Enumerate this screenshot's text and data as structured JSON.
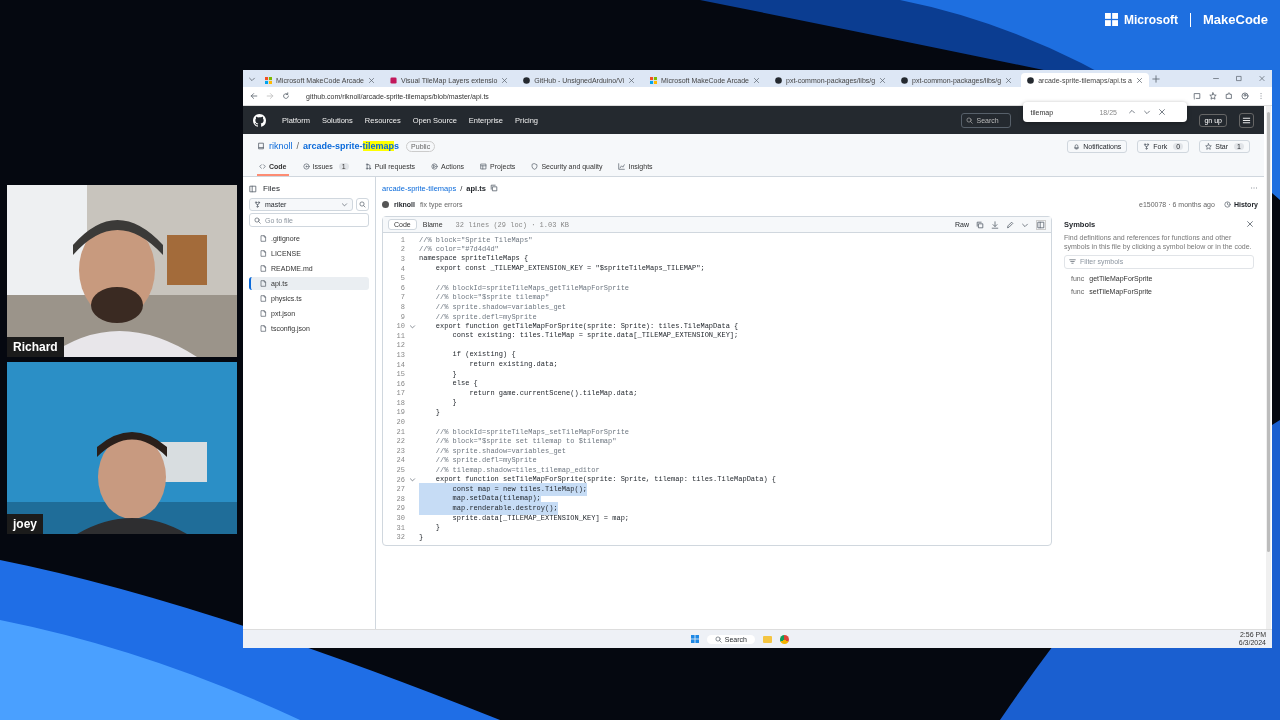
{
  "brand": {
    "company": "Microsoft",
    "name": "MakeCode"
  },
  "participants": [
    {
      "name": "Richard",
      "kind": "picture"
    },
    {
      "name": "joey",
      "kind": "picture"
    }
  ],
  "browser": {
    "tabs": [
      {
        "title": "Microsoft MakeCode Arcade",
        "kind": "makecode",
        "selected": false
      },
      {
        "title": "Visual TileMap Layers extensio",
        "kind": "extension",
        "selected": false
      },
      {
        "title": "GitHub - UnsignedArduino/Vi",
        "kind": "github",
        "selected": false
      },
      {
        "title": "Microsoft MakeCode Arcade",
        "kind": "makecode",
        "selected": false
      },
      {
        "title": "pxt-common-packages/libs/g",
        "kind": "github",
        "selected": false
      },
      {
        "title": "pxt-common-packages/libs/g",
        "kind": "github",
        "selected": false
      },
      {
        "title": "arcade-sprite-tilemaps/api.ts a",
        "kind": "github",
        "selected": true
      }
    ],
    "url": "github.com/riknoll/arcade-sprite-tilemaps/blob/master/api.ts",
    "find_bar": {
      "query": "tilemap",
      "count": "18/25"
    }
  },
  "github": {
    "nav": [
      "Platform",
      "Solutions",
      "Resources",
      "Open Source",
      "Enterprise",
      "Pricing"
    ],
    "search": {
      "placeholder": "Search"
    },
    "signup": "gn up",
    "repo": {
      "owner": "riknoll",
      "separator": "/",
      "name_before": "arcade-sprite-",
      "name_match": "tilemap",
      "name_after": "s",
      "visibility": "Public"
    },
    "actions": [
      {
        "label": "Notifications",
        "kind": "bell"
      },
      {
        "label": "Fork",
        "kind": "fork",
        "count": "0"
      },
      {
        "label": "Star",
        "kind": "star",
        "count": "1"
      }
    ],
    "repo_tabs": [
      {
        "label": "Code",
        "kind": "code",
        "selected": true
      },
      {
        "label": "Issues",
        "kind": "issue",
        "count": "1",
        "selected": false
      },
      {
        "label": "Pull requests",
        "kind": "pr",
        "selected": false
      },
      {
        "label": "Actions",
        "kind": "play",
        "selected": false
      },
      {
        "label": "Projects",
        "kind": "table",
        "selected": false
      },
      {
        "label": "Security and quality",
        "kind": "shield",
        "selected": false
      },
      {
        "label": "Insights",
        "kind": "graph",
        "selected": false
      }
    ]
  },
  "files": {
    "title": "Files",
    "branch": "master",
    "search": {
      "placeholder": "Go to file"
    },
    "items": [
      {
        "name": ".gitignore",
        "selected": false
      },
      {
        "name": "LICENSE",
        "selected": false
      },
      {
        "name": "README.md",
        "selected": false
      },
      {
        "name": "api.ts",
        "selected": true
      },
      {
        "name": "physics.ts",
        "selected": false
      },
      {
        "name": "pxt.json",
        "selected": false
      },
      {
        "name": "tsconfig.json",
        "selected": false
      }
    ]
  },
  "file": {
    "breadcrumb": [
      "arcade-sprite-tilemaps",
      "api.ts"
    ],
    "separator": "/",
    "author": "riknoll",
    "message": "fix type errors",
    "commit": "e150078 · 6 months ago",
    "history": "History",
    "views": [
      {
        "label": "Code",
        "selected": true
      },
      {
        "label": "Blame",
        "selected": false
      }
    ],
    "stats": "32 lines (29 loc) · 1.03 KB",
    "raw": "Raw",
    "lines": [
      {
        "n": "1",
        "text": "//% block=\"Sprite TileMaps\"",
        "kind": "comment",
        "fold": false,
        "selected": false
      },
      {
        "n": "2",
        "text": "//% color=\"#7d4d4d\"",
        "kind": "comment",
        "fold": false,
        "selected": false
      },
      {
        "n": "3",
        "text": "namespace spriteTileMaps {",
        "kind": "code",
        "fold": false,
        "selected": false
      },
      {
        "n": "4",
        "text": "    export const _TILEMAP_EXTENSION_KEY = \"$spriteTileMaps_TILEMAP\";",
        "kind": "code",
        "fold": false,
        "selected": false
      },
      {
        "n": "5",
        "fold": false,
        "selected": false
      },
      {
        "n": "6",
        "text": "    //% blockId=spriteTileMaps_getTileMapForSprite",
        "kind": "comment",
        "fold": false,
        "selected": false
      },
      {
        "n": "7",
        "text": "    //% block=\"$sprite tilemap\"",
        "kind": "comment",
        "fold": false,
        "selected": false
      },
      {
        "n": "8",
        "text": "    //% sprite.shadow=variables_get",
        "kind": "comment",
        "fold": false,
        "selected": false
      },
      {
        "n": "9",
        "text": "    //% sprite.defl=mySprite",
        "kind": "comment",
        "fold": false,
        "selected": false
      },
      {
        "n": "10",
        "text": "    export function getTileMapForSprite(sprite: Sprite): tiles.TileMapData {",
        "kind": "code",
        "fold": true,
        "selected": false
      },
      {
        "n": "11",
        "text": "        const existing: tiles.TileMap = sprite.data[_TILEMAP_EXTENSION_KEY];",
        "kind": "code",
        "fold": false,
        "selected": false
      },
      {
        "n": "12",
        "fold": false,
        "selected": false
      },
      {
        "n": "13",
        "text": "        if (existing) {",
        "kind": "code",
        "fold": false,
        "selected": false
      },
      {
        "n": "14",
        "text": "            return existing.data;",
        "kind": "code",
        "fold": false,
        "selected": false
      },
      {
        "n": "15",
        "text": "        }",
        "kind": "code",
        "fold": false,
        "selected": false
      },
      {
        "n": "16",
        "text": "        else {",
        "kind": "code",
        "fold": false,
        "selected": false
      },
      {
        "n": "17",
        "text": "            return game.currentScene().tileMap.data;",
        "kind": "code",
        "fold": false,
        "selected": false
      },
      {
        "n": "18",
        "text": "        }",
        "kind": "code",
        "fold": false,
        "selected": false
      },
      {
        "n": "19",
        "text": "    }",
        "kind": "code",
        "fold": false,
        "selected": false
      },
      {
        "n": "20",
        "fold": false,
        "selected": false
      },
      {
        "n": "21",
        "text": "    //% blockId=spriteTileMaps_setTileMapForSprite",
        "kind": "comment",
        "fold": false,
        "selected": false
      },
      {
        "n": "22",
        "text": "    //% block=\"$sprite set tilemap to $tilemap\"",
        "kind": "comment",
        "fold": false,
        "selected": false
      },
      {
        "n": "23",
        "text": "    //% sprite.shadow=variables_get",
        "kind": "comment",
        "fold": false,
        "selected": false
      },
      {
        "n": "24",
        "text": "    //% sprite.defl=mySprite",
        "kind": "comment",
        "fold": false,
        "selected": false
      },
      {
        "n": "25",
        "text": "    //% tilemap.shadow=tiles_tilemap_editor",
        "kind": "comment",
        "fold": false,
        "selected": false
      },
      {
        "n": "26",
        "text": "    export function setTileMapForSprite(sprite: Sprite, tilemap: tiles.TileMapData) {",
        "kind": "code",
        "fold": true,
        "selected": false
      },
      {
        "n": "27",
        "text": "        const map = new tiles.TileMap();",
        "kind": "code",
        "fold": false,
        "selected": true
      },
      {
        "n": "28",
        "text": "        map.setData(tilemap);",
        "kind": "code",
        "fold": false,
        "selected": true
      },
      {
        "n": "29",
        "text": "        map.renderable.destroy();",
        "kind": "code",
        "fold": false,
        "selected": true
      },
      {
        "n": "30",
        "text": "        sprite.data[_TILEMAP_EXTENSION_KEY] = map;",
        "kind": "code",
        "fold": false,
        "selected": false
      },
      {
        "n": "31",
        "text": "    }",
        "kind": "code",
        "fold": false,
        "selected": false
      },
      {
        "n": "32",
        "text": "}",
        "kind": "code",
        "fold": false,
        "selected": false
      }
    ]
  },
  "symbols": {
    "title": "Symbols",
    "description": "Find definitions and references for functions and other symbols in this file by clicking a symbol below or in the code.",
    "filter": {
      "placeholder": "Filter symbols"
    },
    "items": [
      {
        "kind": "func",
        "name": "getTileMapForSprite"
      },
      {
        "kind": "func",
        "name": "setTileMapForSprite"
      }
    ]
  },
  "taskbar": {
    "search": "Search",
    "time": "2:56 PM",
    "date": "6/3/2024"
  }
}
